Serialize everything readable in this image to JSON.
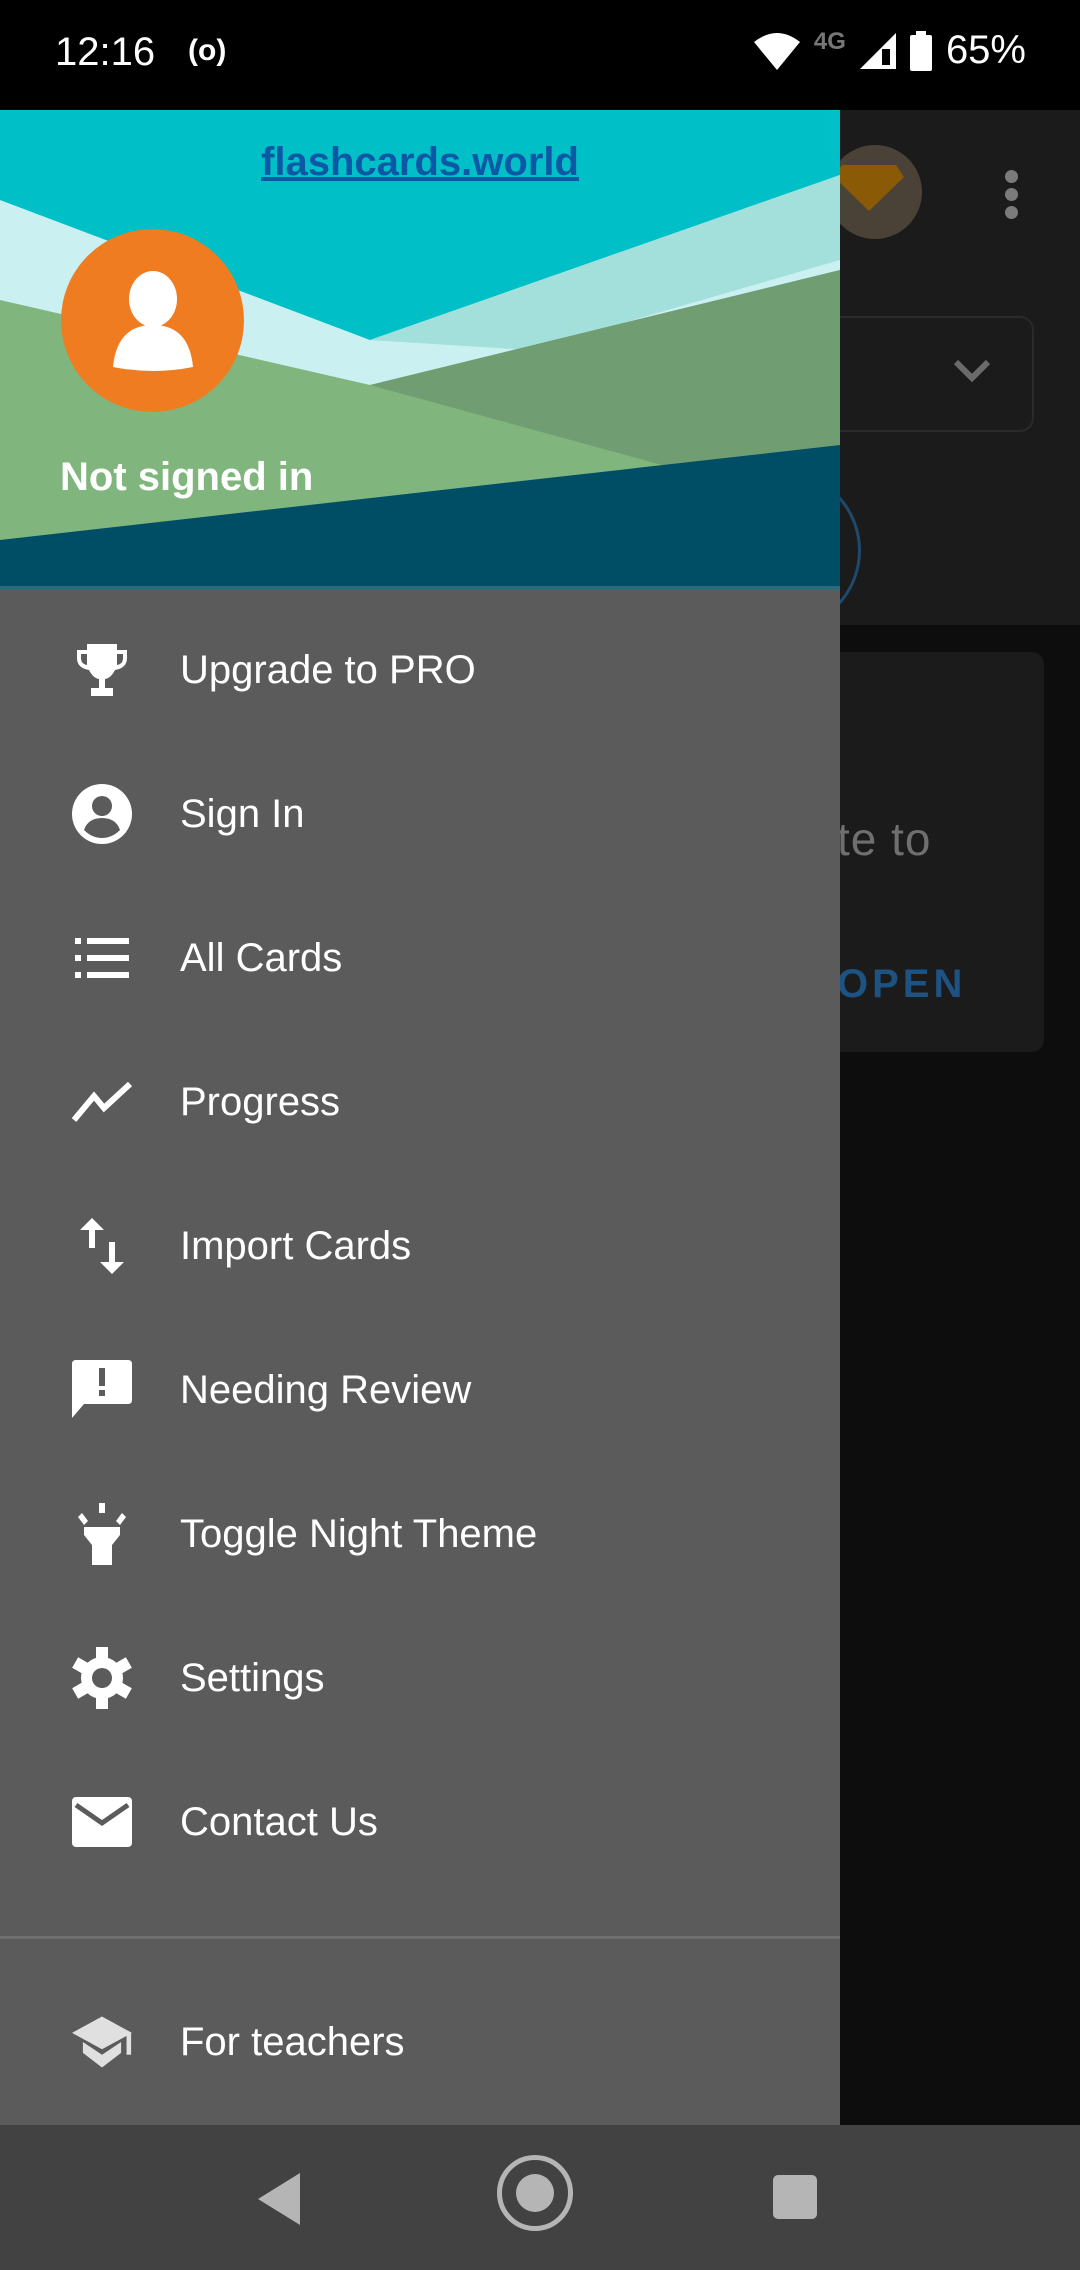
{
  "status_bar": {
    "time": "12:16",
    "radio_icon": "((o))",
    "network": "4G",
    "battery": "65%",
    "icons": [
      "wifi-icon",
      "signal-icon",
      "battery-icon"
    ]
  },
  "background_app": {
    "card_text_fragment": "te to",
    "card_button_fragment": "OPEN",
    "icons": [
      "gem-icon",
      "more-vert-icon",
      "chevron-down-icon"
    ]
  },
  "drawer": {
    "header": {
      "site_link": "flashcards.world",
      "user_status": "Not signed in",
      "avatar_icon": "person-icon"
    },
    "menu_items": [
      {
        "label": "Upgrade to PRO",
        "icon": "trophy-icon"
      },
      {
        "label": "Sign In",
        "icon": "account-circle-icon"
      },
      {
        "label": "All Cards",
        "icon": "list-icon"
      },
      {
        "label": "Progress",
        "icon": "trending-up-icon"
      },
      {
        "label": "Import Cards",
        "icon": "import-export-icon"
      },
      {
        "label": "Needing Review",
        "icon": "feedback-icon"
      },
      {
        "label": "Toggle Night Theme",
        "icon": "flashlight-icon"
      },
      {
        "label": "Settings",
        "icon": "gear-icon"
      },
      {
        "label": "Contact Us",
        "icon": "mail-icon"
      }
    ],
    "footer_item": {
      "label": "For teachers",
      "icon": "school-icon"
    }
  },
  "colors": {
    "header_teal": "#00bfc6",
    "avatar_orange": "#f07c22",
    "drawer_bg": "#5b5b5b",
    "link_blue": "#0d58a6"
  },
  "nav_bar": {
    "buttons": [
      "back",
      "home",
      "recents"
    ]
  }
}
